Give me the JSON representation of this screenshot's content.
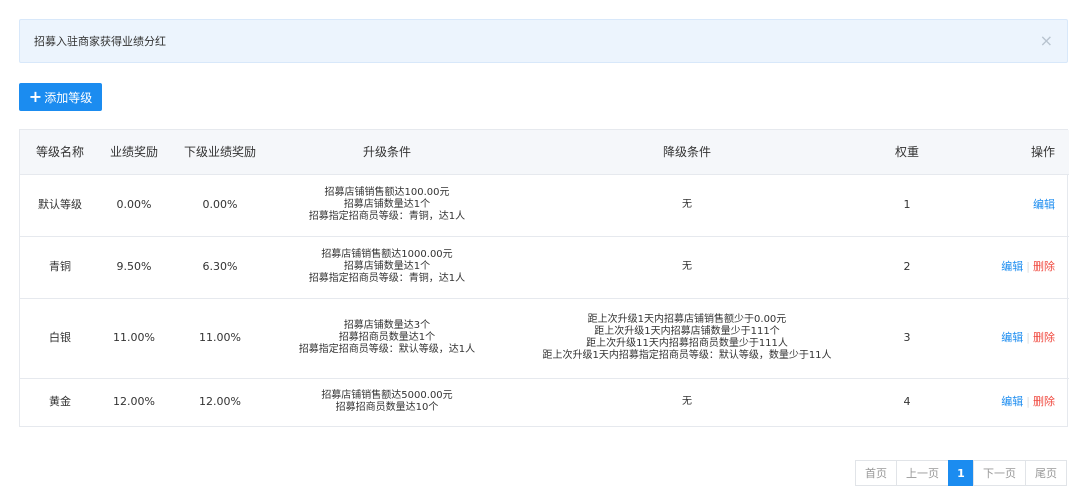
{
  "alert": {
    "text": "招募入驻商家获得业绩分红",
    "close_symbol": "×"
  },
  "add_button": {
    "icon": "+",
    "label": "添加等级"
  },
  "table": {
    "headers": {
      "name": "等级名称",
      "reward": "业绩奖励",
      "sub_reward": "下级业绩奖励",
      "upgrade": "升级条件",
      "downgrade": "降级条件",
      "weight": "权重",
      "ops": "操作"
    },
    "rows": [
      {
        "name": "默认等级",
        "reward": "0.00%",
        "sub_reward": "0.00%",
        "upgrade": [
          "招募店铺销售额达100.00元",
          "招募店铺数量达1个",
          "招募指定招商员等级：青铜，达1人"
        ],
        "downgrade": [
          "无"
        ],
        "weight": "1",
        "edit": "编辑",
        "delete": ""
      },
      {
        "name": "青铜",
        "reward": "9.50%",
        "sub_reward": "6.30%",
        "upgrade": [
          "招募店铺销售额达1000.00元",
          "招募店铺数量达1个",
          "招募指定招商员等级：青铜，达1人"
        ],
        "downgrade": [
          "无"
        ],
        "weight": "2",
        "edit": "编辑",
        "delete": "删除"
      },
      {
        "name": "白银",
        "reward": "11.00%",
        "sub_reward": "11.00%",
        "upgrade": [
          "招募店铺数量达3个",
          "招募招商员数量达1个",
          "招募指定招商员等级：默认等级，达1人"
        ],
        "downgrade": [
          "距上次升级1天内招募店铺销售额少于0.00元",
          "距上次升级1天内招募店铺数量少于111个",
          "距上次升级11天内招募招商员数量少于111人",
          "距上次升级1天内招募指定招商员等级：默认等级，数量少于11人"
        ],
        "weight": "3",
        "edit": "编辑",
        "delete": "删除"
      },
      {
        "name": "黄金",
        "reward": "12.00%",
        "sub_reward": "12.00%",
        "upgrade": [
          "招募店铺销售额达5000.00元",
          "招募招商员数量达10个"
        ],
        "downgrade": [
          "无"
        ],
        "weight": "4",
        "edit": "编辑",
        "delete": "删除"
      }
    ]
  },
  "pagination": {
    "first": "首页",
    "prev": "上一页",
    "current": "1",
    "next": "下一页",
    "last": "尾页"
  },
  "colors": {
    "accent": "#1b8cf0",
    "danger": "#f0483e",
    "alert_bg": "#ecf4fd"
  }
}
